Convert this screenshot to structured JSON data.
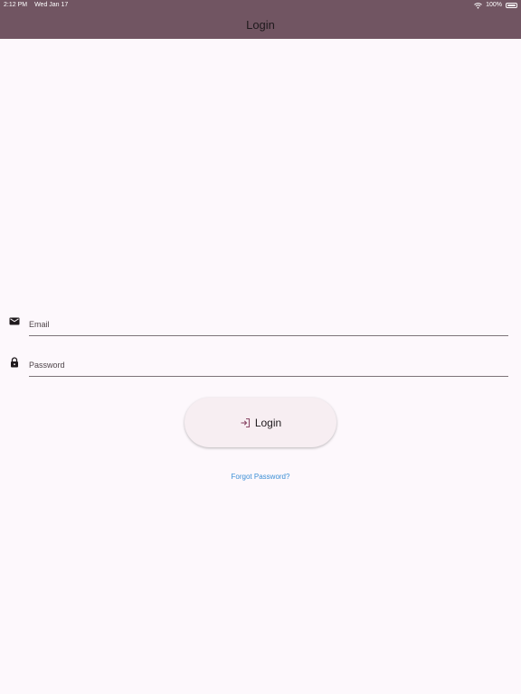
{
  "status_bar": {
    "time": "2:12 PM",
    "date": "Wed Jan 17",
    "battery": "100%"
  },
  "app_bar": {
    "title": "Login"
  },
  "form": {
    "email_placeholder": "Email",
    "password_placeholder": "Password",
    "login_label": "Login",
    "forgot_label": "Forgot Password?"
  },
  "colors": {
    "app_bar": "#715562",
    "background": "#fdf8fc",
    "button_bg": "#f7eef2",
    "link": "#3b8fd6",
    "icon_accent": "#8b4a68"
  },
  "icons": {
    "email": "email-icon",
    "password": "lock-icon",
    "login": "login-icon",
    "wifi": "wifi-icon",
    "battery": "battery-icon"
  }
}
